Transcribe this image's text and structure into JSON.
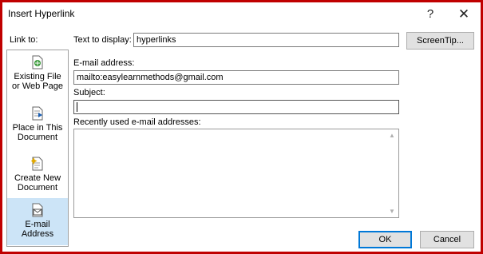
{
  "window": {
    "title": "Insert Hyperlink",
    "help_glyph": "?",
    "close_glyph": "✕"
  },
  "linkto": {
    "label": "Link to:",
    "items": [
      {
        "line1": "Existing File",
        "line2": "or Web Page",
        "icon": "existing-file-icon",
        "selected": false
      },
      {
        "line1": "Place in This",
        "line2": "Document",
        "icon": "place-in-document-icon",
        "selected": false
      },
      {
        "line1": "Create New",
        "line2": "Document",
        "icon": "new-document-icon",
        "selected": false
      },
      {
        "line1": "E-mail",
        "line2": "Address",
        "icon": "email-icon",
        "selected": true
      }
    ]
  },
  "display": {
    "label": "Text to display:",
    "value": "hyperlinks"
  },
  "screentip": {
    "label": "ScreenTip..."
  },
  "email": {
    "label": "E-mail address:",
    "value": "mailto:easylearnmethods@gmail.com"
  },
  "subject": {
    "label": "Subject:",
    "value": ""
  },
  "recent": {
    "label": "Recently used e-mail addresses:",
    "items": []
  },
  "buttons": {
    "ok": "OK",
    "cancel": "Cancel"
  }
}
